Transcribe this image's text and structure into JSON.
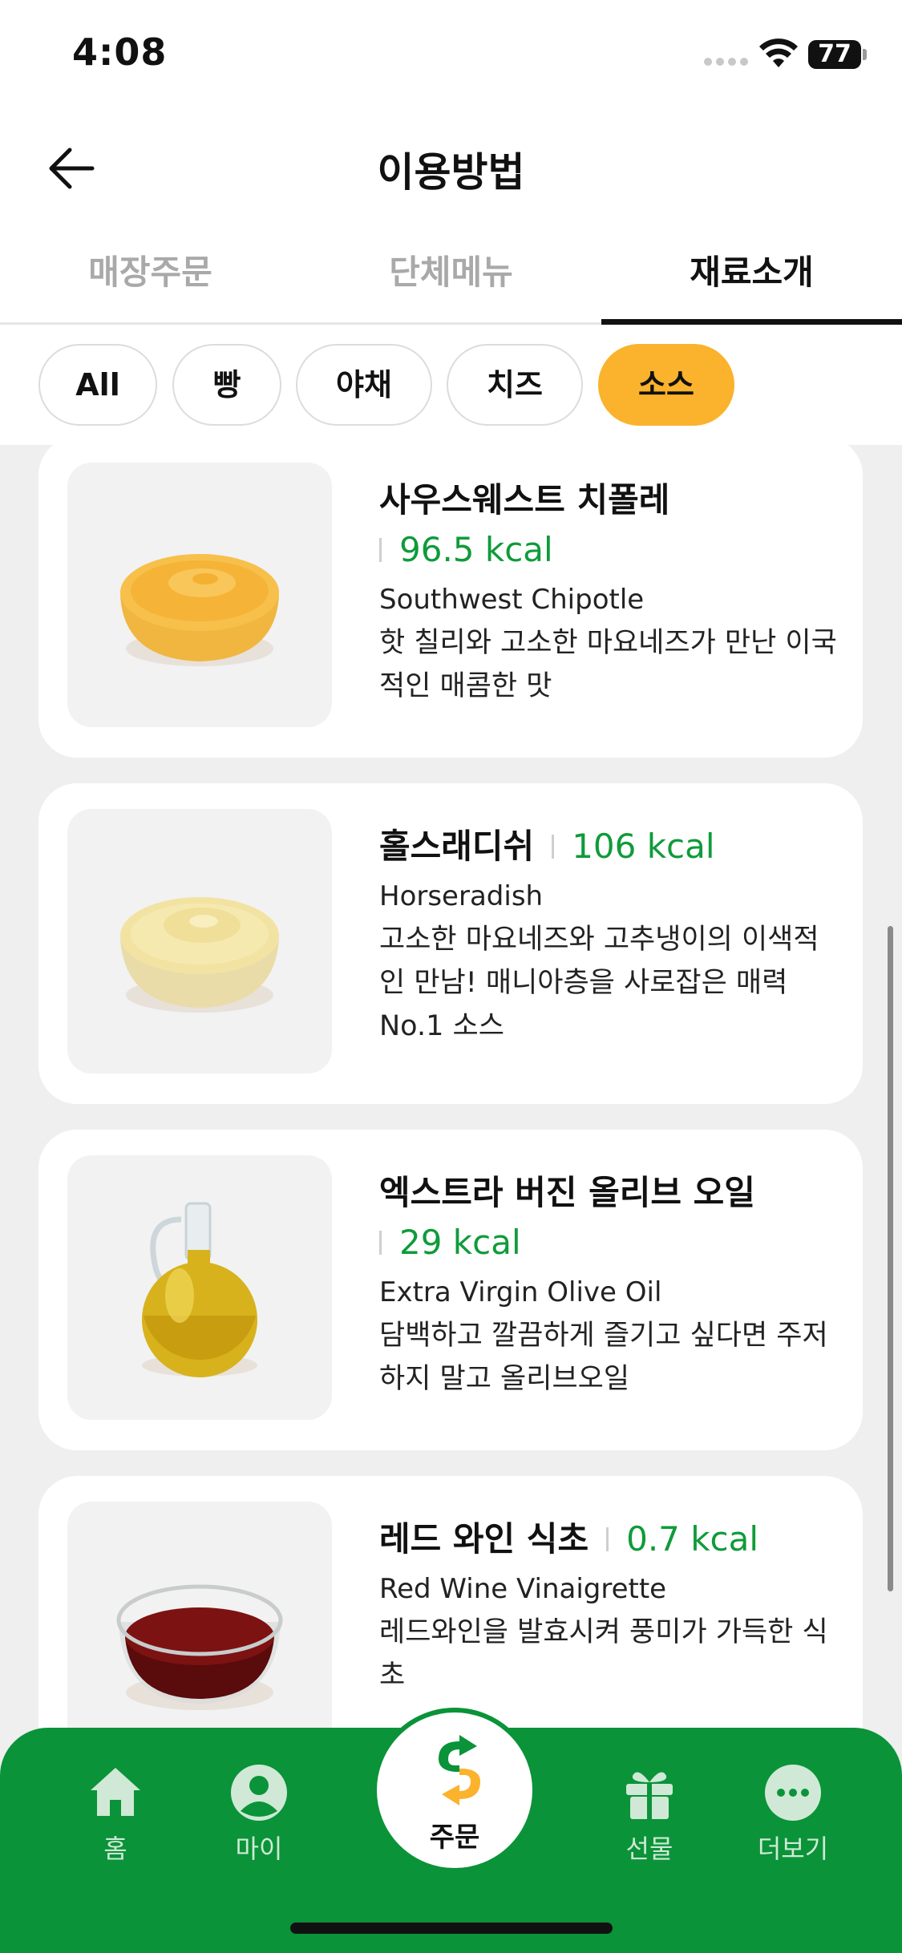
{
  "status": {
    "time": "4:08",
    "battery": "77"
  },
  "header": {
    "title": "이용방법",
    "back_icon": "arrow-left-icon"
  },
  "tabs": [
    {
      "label": "매장주문",
      "active": false
    },
    {
      "label": "단체메뉴",
      "active": false
    },
    {
      "label": "재료소개",
      "active": true
    }
  ],
  "filters": [
    {
      "label": "All",
      "active": false
    },
    {
      "label": "빵",
      "active": false
    },
    {
      "label": "야채",
      "active": false
    },
    {
      "label": "치즈",
      "active": false
    },
    {
      "label": "소스",
      "active": true
    }
  ],
  "items": [
    {
      "name": "사우스웨스트 치폴레",
      "kcal": "96.5 kcal",
      "en": "Southwest Chipotle",
      "desc": "핫 칠리와 고소한 마요네즈가 만난 이국적인 매콤한 맛",
      "image": "chipotle-sauce-bowl"
    },
    {
      "name": "홀스래디쉬",
      "kcal": "106 kcal",
      "en": "Horseradish",
      "desc": "고소한 마요네즈와 고추냉이의 이색적인 만남! 매니아층을 사로잡은 매력 No.1 소스",
      "image": "horseradish-sauce-bowl"
    },
    {
      "name": "엑스트라 버진 올리브 오일",
      "kcal": "29 kcal",
      "en": "Extra Virgin Olive Oil",
      "desc": "담백하고 깔끔하게 즐기고 싶다면 주저하지 말고 올리브오일",
      "image": "olive-oil-bottle"
    },
    {
      "name": "레드 와인 식초",
      "kcal": "0.7 kcal",
      "en": "Red Wine Vinaigrette",
      "desc": "레드와인을 발효시켜 풍미가 가득한 식초",
      "image": "red-wine-vinegar-bowl"
    }
  ],
  "nav": {
    "home": "홈",
    "my": "마이",
    "order": "주문",
    "gift": "선물",
    "more": "더보기"
  },
  "colors": {
    "brand_green": "#0a9338",
    "accent_yellow": "#fbb22c",
    "kcal_green": "#0f9b3a"
  }
}
